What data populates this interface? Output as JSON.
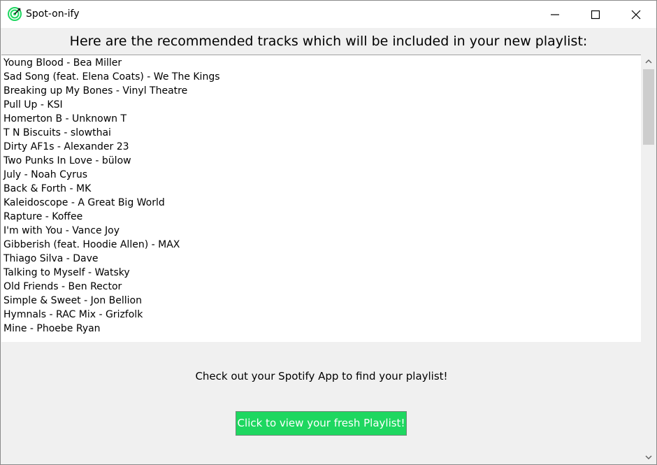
{
  "window": {
    "title": "Spot-on-ify",
    "controls": [
      "minimize",
      "maximize",
      "close"
    ]
  },
  "heading": "Here are the recommended tracks which will be included in your new playlist:",
  "tracks": [
    "Young Blood - Bea Miller",
    "Sad Song (feat. Elena Coats) - We The Kings",
    "Breaking up My Bones - Vinyl Theatre",
    "Pull Up - KSI",
    "Homerton B - Unknown T",
    "T N Biscuits - slowthai",
    "Dirty AF1s - Alexander 23",
    "Two Punks In Love - bülow",
    "July - Noah Cyrus",
    "Back & Forth - MK",
    "Kaleidoscope - A Great Big World",
    "Rapture - Koffee",
    "I'm with You - Vance Joy",
    "Gibberish (feat. Hoodie Allen) - MAX",
    "Thiago Silva - Dave",
    "Talking to Myself - Watsky",
    "Old Friends - Ben Rector",
    "Simple & Sweet - Jon Bellion",
    "Hymnals - RAC Mix - Grizfolk",
    "Mine - Phoebe Ryan"
  ],
  "footer_text": "Check out your Spotify App to find your playlist!",
  "cta_button_label": "Click to view your fresh Playlist!",
  "colors": {
    "brand_green": "#1ed760",
    "window_bg": "#f0f0f0",
    "list_bg": "#ffffff"
  }
}
